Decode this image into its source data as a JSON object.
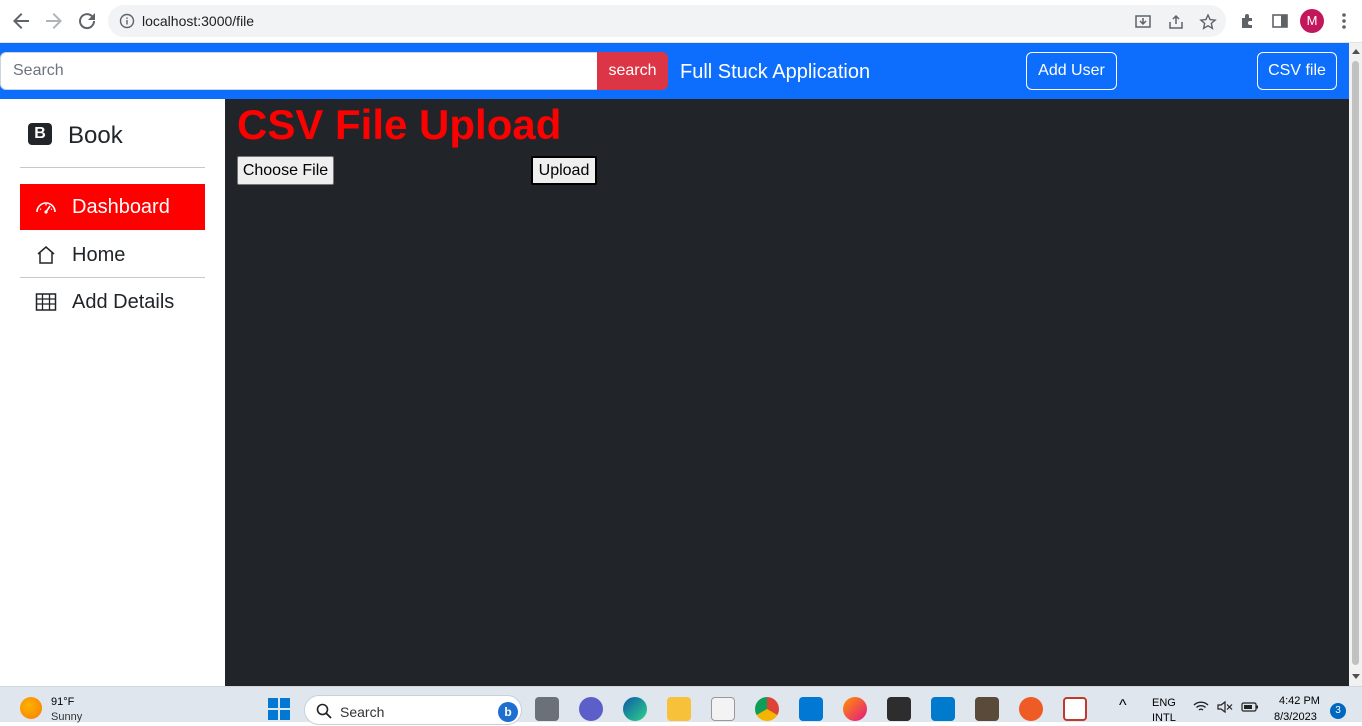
{
  "browser": {
    "url": "localhost:3000/file",
    "profile_initial": "M"
  },
  "topnav": {
    "search_placeholder": "Search",
    "search_button": "search",
    "brand": "Full Stuck Application",
    "add_user_button": "Add User",
    "csv_file_button": "CSV file",
    "bg_color": "#0d6efd"
  },
  "sidebar": {
    "logo_letter": "B",
    "logo_text": "Book",
    "items": [
      {
        "label": "Dashboard",
        "icon": "speedometer-icon",
        "active": true
      },
      {
        "label": "Home",
        "icon": "home-icon",
        "active": false
      },
      {
        "label": "Add Details",
        "icon": "table-icon",
        "active": false
      }
    ],
    "active_color": "#ff0000"
  },
  "main": {
    "title": "CSV File Upload",
    "choose_file_button": "Choose File",
    "upload_button": "Upload",
    "title_color": "#ff0000",
    "bg_color": "#212529"
  },
  "taskbar": {
    "weather_temp": "91°F",
    "weather_desc": "Sunny",
    "search_label": "Search",
    "language_line1": "ENG",
    "language_line2": "INTL",
    "time": "4:42 PM",
    "date": "8/3/2023",
    "notification_count": "3"
  }
}
